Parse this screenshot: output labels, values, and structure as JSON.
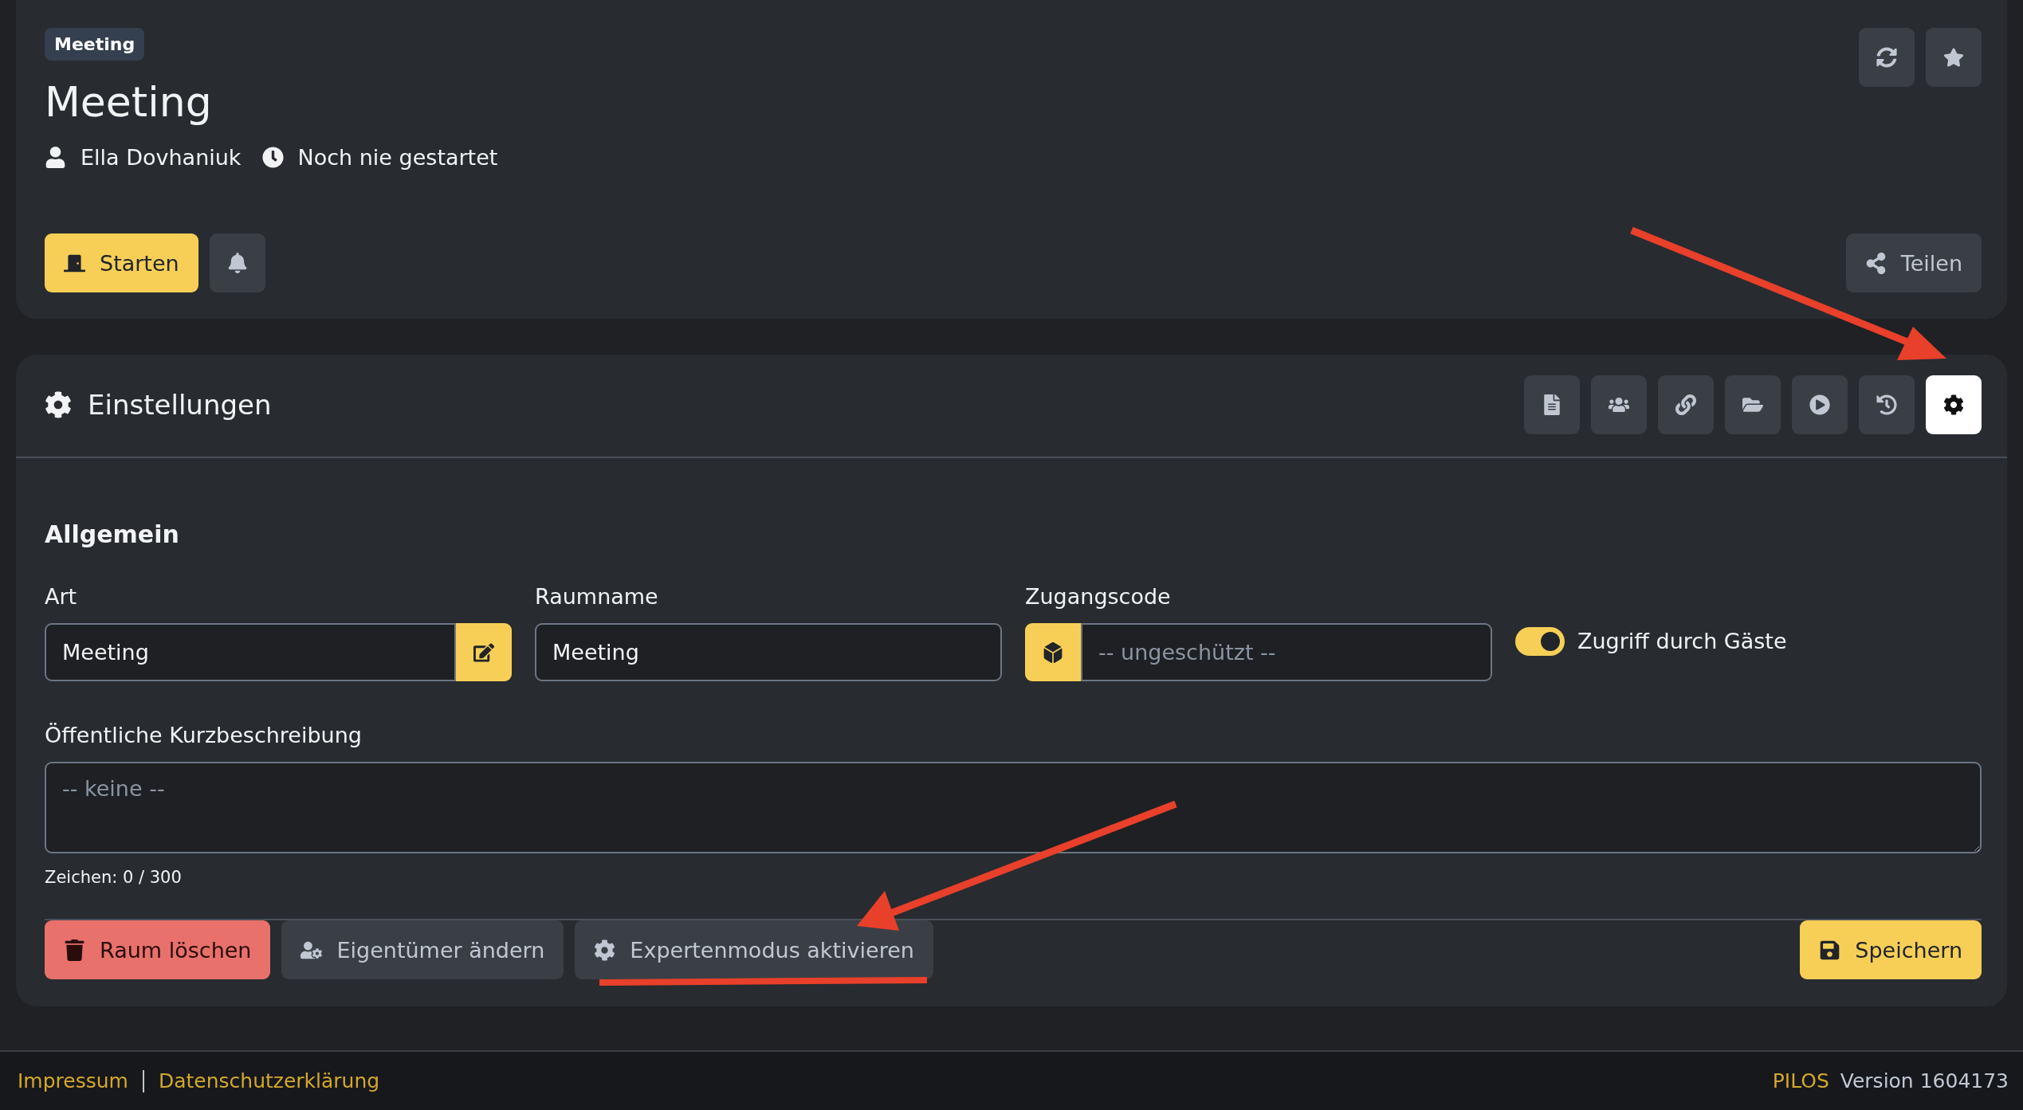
{
  "room": {
    "badge": "Meeting",
    "title": "Meeting",
    "owner": "Ella Dovhaniuk",
    "last_started": "Noch nie gestartet"
  },
  "header_actions": {
    "start": "Starten",
    "share": "Teilen"
  },
  "settings": {
    "title": "Einstellungen",
    "tabs": [
      {
        "selected": false
      },
      {
        "selected": false
      },
      {
        "selected": false
      },
      {
        "selected": false
      },
      {
        "selected": false
      },
      {
        "selected": false
      },
      {
        "selected": true
      }
    ],
    "section": "Allgemein",
    "fields": [
      {
        "kind": "edit",
        "label": "Art",
        "value": "Meeting"
      },
      {
        "kind": "text",
        "label": "Raumname",
        "value": "Meeting"
      },
      {
        "kind": "code",
        "label": "Zugangscode",
        "placeholder": "-- ungeschützt --"
      }
    ],
    "guest_access": {
      "label": "Zugriff durch Gäste",
      "on": true
    },
    "description": {
      "label": "Öffentliche Kurzbeschreibung",
      "placeholder": "-- keine --",
      "counter": "Zeichen: 0 / 300"
    },
    "actions": [
      {
        "kind": "danger",
        "label": "Raum löschen"
      },
      {
        "kind": "owner",
        "label": "Eigentümer ändern"
      },
      {
        "kind": "expert",
        "label": "Expertenmodus aktivieren"
      }
    ],
    "save": "Speichern"
  },
  "footer": {
    "links": [
      "Impressum",
      "Datenschutzerklärung"
    ],
    "brand": "PILOS",
    "version": "Version 1604173"
  }
}
